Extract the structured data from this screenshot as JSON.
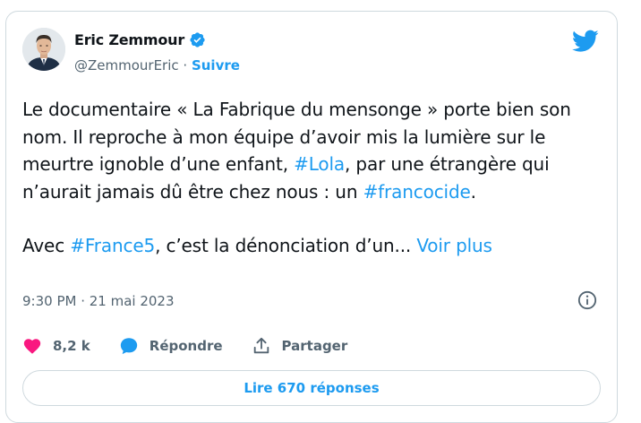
{
  "author": {
    "display_name": "Eric Zemmour",
    "handle": "@ZemmourEric",
    "separator": " · ",
    "follow_label": "Suivre"
  },
  "tweet": {
    "p1_t1": "Le documentaire « La Fabrique du mensonge » porte bien son nom. Il reproche à mon équipe d’avoir mis la lumière sur le meurtre ignoble d’une enfant, ",
    "p1_tag1": "#Lola",
    "p1_t2": ", par une étrangère qui n’aurait jamais dû être chez nous : un ",
    "p1_tag2": "#francocide",
    "p1_t3": ".",
    "p2_t1": "Avec ",
    "p2_tag1": "#France5",
    "p2_t2": ", c’est la dénonciation d’un... ",
    "read_more": "Voir plus"
  },
  "timestamp": "9:30 PM · 21 mai 2023",
  "actions": {
    "likes_count": "8,2 k",
    "reply_label": "Répondre",
    "share_label": "Partager"
  },
  "replies_button_label": "Lire 670 réponses",
  "colors": {
    "accent": "#1d9bf0",
    "like": "#f91880",
    "text": "#0f1419",
    "muted": "#536471",
    "border": "#cfd9de"
  },
  "icons": [
    "verified-badge-icon",
    "twitter-bird-icon",
    "info-icon",
    "heart-icon",
    "reply-bubble-icon",
    "share-icon"
  ]
}
